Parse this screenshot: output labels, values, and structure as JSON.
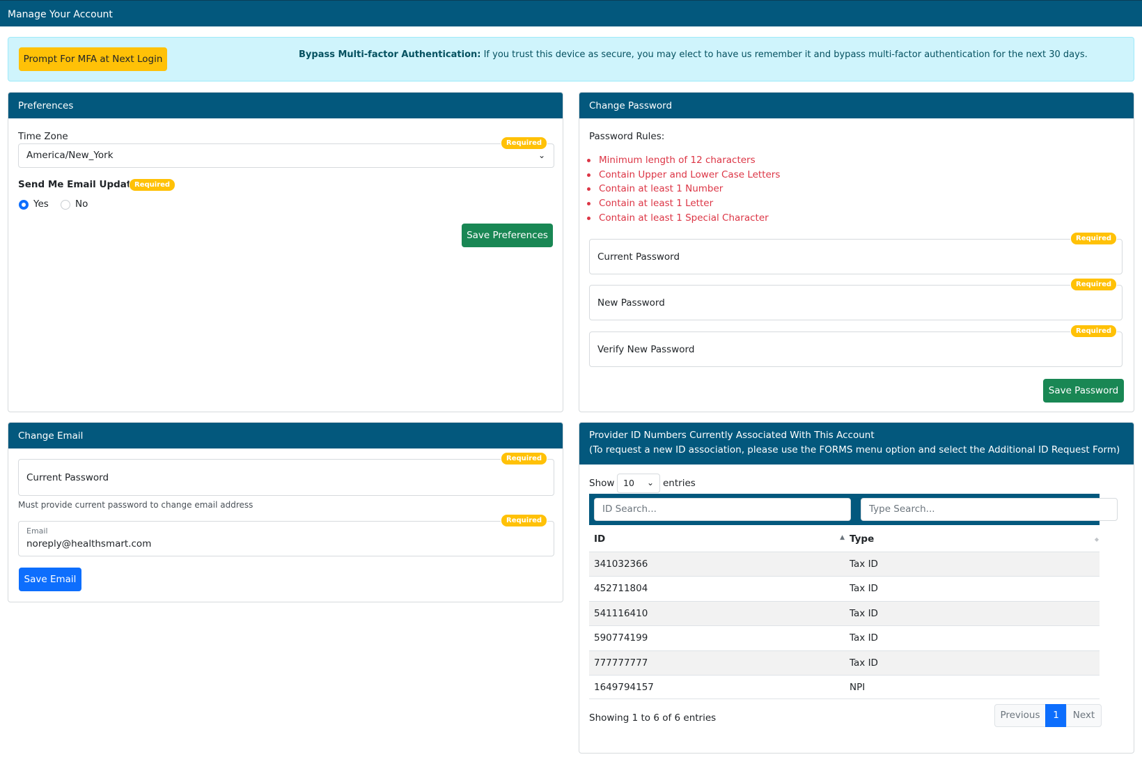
{
  "page": {
    "title": "Manage Your Account"
  },
  "mfa_alert": {
    "button_label": "Prompt For MFA at Next Login",
    "heading": "Bypass Multi-factor Authentication:",
    "text": " If you trust this device as secure, you may elect to have us remember it and bypass multi-factor authentication for the next 30 days."
  },
  "preferences": {
    "header": "Preferences",
    "timezone_label": "Time Zone",
    "timezone_value": "America/New_York",
    "required_badge": "Required",
    "email_updates_label": "Send Me Email Updates",
    "option_yes": "Yes",
    "option_no": "No",
    "selected": "Yes",
    "save_label": "Save Preferences"
  },
  "change_password": {
    "header": "Change Password",
    "rules_label": "Password Rules:",
    "rules": [
      "Minimum length of 12 characters",
      "Contain Upper and Lower Case Letters",
      "Contain at least 1 Number",
      "Contain at least 1 Letter",
      "Contain at least 1 Special Character"
    ],
    "required_badge": "Required",
    "current_password_placeholder": "Current Password",
    "new_password_placeholder": "New Password",
    "verify_password_placeholder": "Verify New Password",
    "save_label": "Save Password"
  },
  "change_email": {
    "header": "Change Email",
    "required_badge": "Required",
    "current_password_placeholder": "Current Password",
    "help_text": "Must provide current password to change email address",
    "email_label": "Email",
    "email_value": "noreply@healthsmart.com",
    "save_label": "Save Email"
  },
  "provider_ids": {
    "header_line1": "Provider ID Numbers Currently Associated With This Account",
    "header_line2": "(To request a new ID association, please use the FORMS menu option and select the Additional ID Request Form)",
    "show_label": "Show",
    "page_size": "10",
    "entries_label": "entries",
    "id_search_placeholder": "ID Search...",
    "type_search_placeholder": "Type Search...",
    "columns": [
      "ID",
      "Type"
    ],
    "rows": [
      {
        "id": "341032366",
        "type": "Tax ID"
      },
      {
        "id": "452711804",
        "type": "Tax ID"
      },
      {
        "id": "541116410",
        "type": "Tax ID"
      },
      {
        "id": "590774199",
        "type": "Tax ID"
      },
      {
        "id": "777777777",
        "type": "Tax ID"
      },
      {
        "id": "1649794157",
        "type": "NPI"
      }
    ],
    "info": "Showing 1 to 6 of 6 entries",
    "prev_label": "Previous",
    "current_page": "1",
    "next_label": "Next"
  }
}
